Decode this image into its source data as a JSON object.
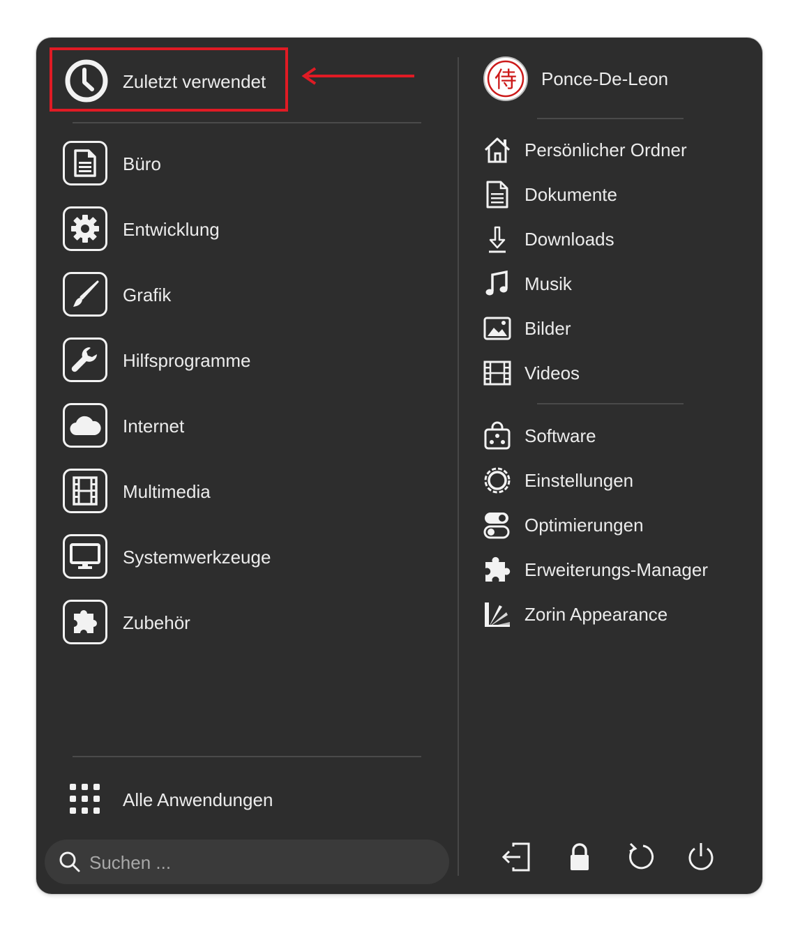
{
  "left": {
    "recent_label": "Zuletzt verwendet",
    "categories": [
      {
        "label": "Büro",
        "icon": "document-icon"
      },
      {
        "label": "Entwicklung",
        "icon": "gear-icon"
      },
      {
        "label": "Grafik",
        "icon": "brush-icon"
      },
      {
        "label": "Hilfsprogramme",
        "icon": "wrench-icon"
      },
      {
        "label": "Internet",
        "icon": "cloud-icon"
      },
      {
        "label": "Multimedia",
        "icon": "film-icon"
      },
      {
        "label": "Systemwerkzeuge",
        "icon": "monitor-icon"
      },
      {
        "label": "Zubehör",
        "icon": "puzzle-icon"
      }
    ],
    "all_apps_label": "Alle Anwendungen",
    "search": {
      "placeholder": "Suchen ..."
    }
  },
  "right": {
    "user_name": "Ponce-De-Leon",
    "avatar_glyph": "侍",
    "places": [
      {
        "label": "Persönlicher Ordner",
        "icon": "home-icon"
      },
      {
        "label": "Dokumente",
        "icon": "document-icon"
      },
      {
        "label": "Downloads",
        "icon": "download-icon"
      },
      {
        "label": "Musik",
        "icon": "music-icon"
      },
      {
        "label": "Bilder",
        "icon": "image-icon"
      },
      {
        "label": "Videos",
        "icon": "film-icon"
      }
    ],
    "apps": [
      {
        "label": "Software",
        "icon": "software-bag-icon"
      },
      {
        "label": "Einstellungen",
        "icon": "settings-gear-icon"
      },
      {
        "label": "Optimierungen",
        "icon": "toggle-icon"
      },
      {
        "label": "Erweiterungs-Manager",
        "icon": "puzzle-icon"
      },
      {
        "label": "Zorin Appearance",
        "icon": "zorin-appearance-icon"
      }
    ],
    "session_buttons": [
      "logout-icon",
      "lock-icon",
      "restart-icon",
      "power-icon"
    ]
  },
  "colors": {
    "panel_bg": "#2d2d2d",
    "highlight": "#e01b24",
    "text": "#ececec",
    "avatar_red": "#cc1a1a"
  }
}
